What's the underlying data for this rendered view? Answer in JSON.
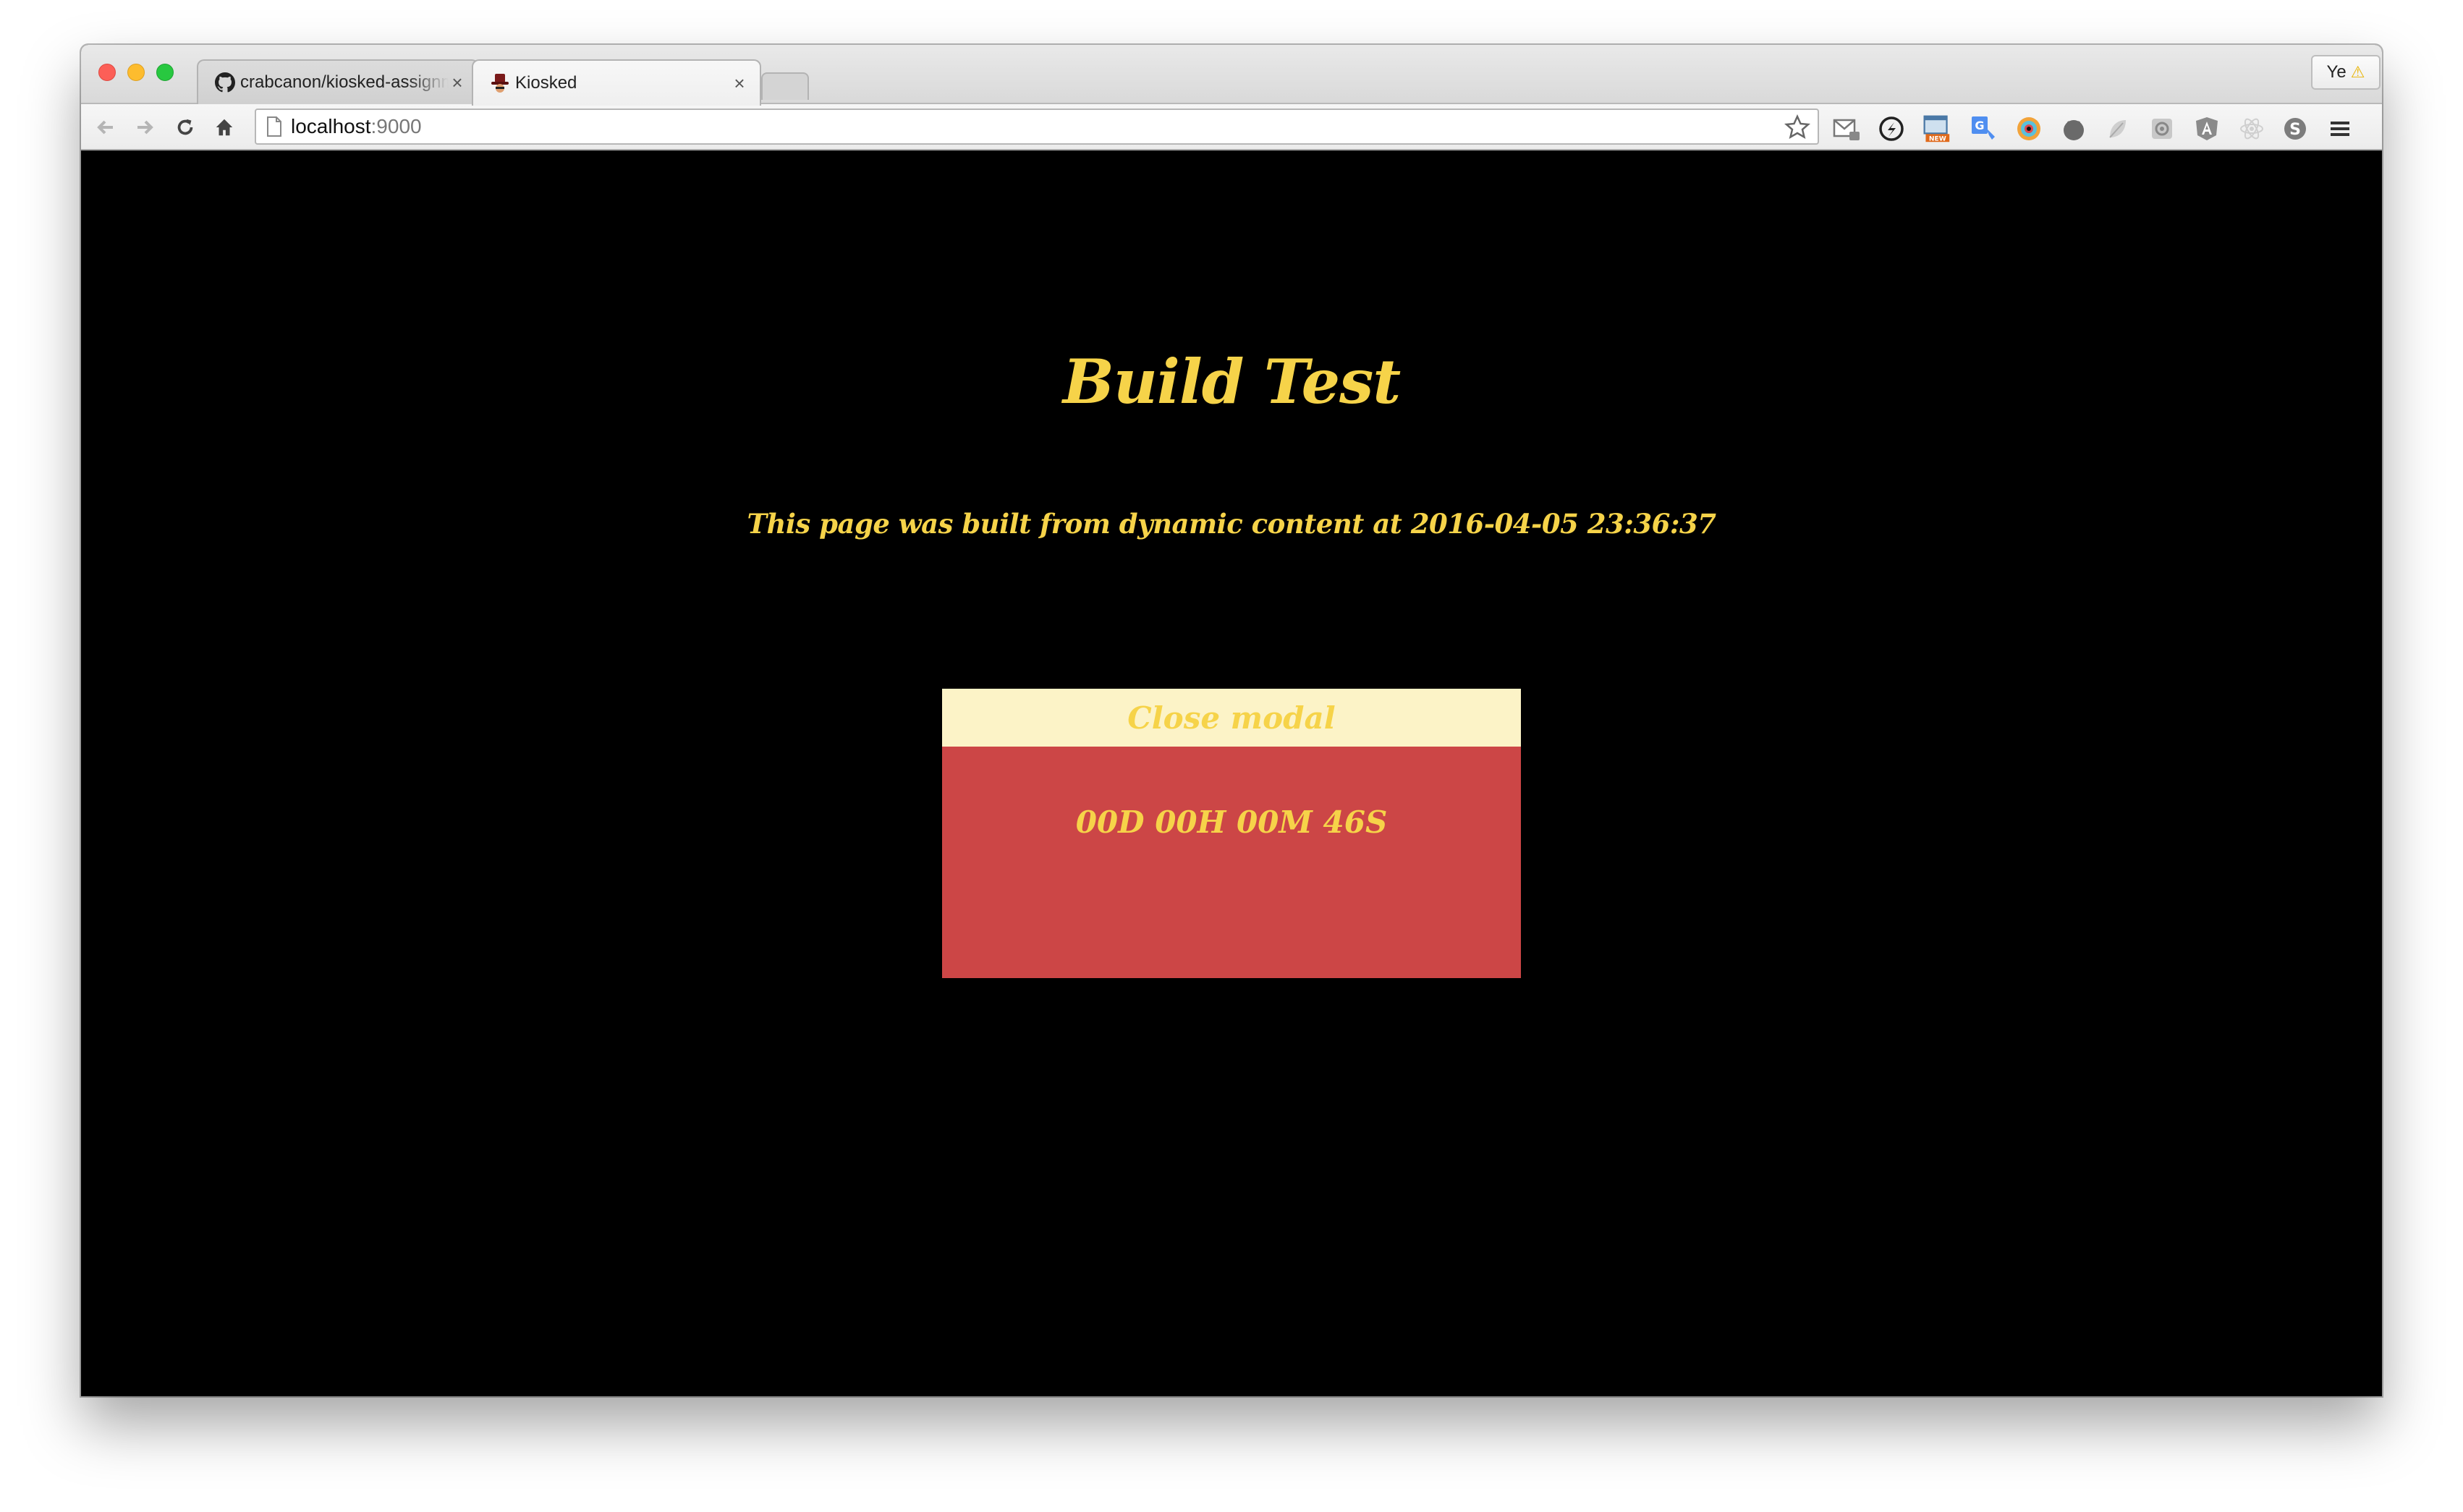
{
  "browser": {
    "tabs": [
      {
        "title": "crabcanon/kiosked-assignment",
        "favicon": "github-icon",
        "close": "×"
      },
      {
        "title": "Kiosked",
        "favicon": "kiosked-hat-icon",
        "close": "×"
      }
    ],
    "profile": {
      "label": "Ye",
      "badge": "⚠"
    },
    "address": {
      "host": "localhost",
      "port": ":9000"
    },
    "extensions": [
      "gmail-checker-icon",
      "compass-icon",
      "new-feature-icon",
      "google-translate-icon",
      "color-picker-icon",
      "dark-circle-icon",
      "gray-leaf-icon",
      "gear-cog-icon",
      "angular-icon",
      "react-icon",
      "skype-icon"
    ]
  },
  "page": {
    "title": "Build Test",
    "subtitle": "This page was built from dynamic content at 2016-04-05 23:36:37",
    "modal": {
      "close_label": "Close modal",
      "countdown": "00D 00H 00M 46S"
    }
  },
  "colors": {
    "accent_text": "#f6d349",
    "modal_header_bg": "#fcf3c7",
    "modal_body_bg": "#cc4646",
    "page_bg": "#000000"
  }
}
